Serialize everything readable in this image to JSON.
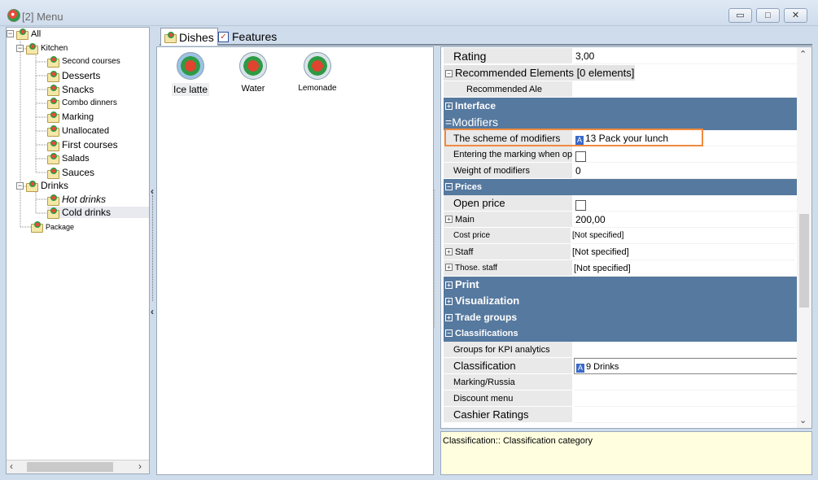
{
  "window": {
    "title": "[2] Menu",
    "buttons": [
      "minimize",
      "restore",
      "close"
    ]
  },
  "tree": {
    "root": "All",
    "groups": [
      {
        "label": "Kitchen",
        "children": [
          "Second courses",
          "Desserts",
          "Snacks",
          "Combo dinners",
          "Marking",
          "Unallocated",
          "First courses",
          "Salads",
          "Sauces"
        ]
      },
      {
        "label": "Drinks",
        "children": [
          "Hot drinks",
          "Cold drinks"
        ]
      },
      {
        "label": "Package",
        "children": []
      }
    ],
    "selected": "Cold drinks"
  },
  "tabs": [
    {
      "label": "Dishes",
      "active": true
    },
    {
      "label": "Features",
      "active": false
    }
  ],
  "dishes": [
    {
      "label": "Ice latte",
      "selected": true
    },
    {
      "label": "Water",
      "selected": false
    },
    {
      "label": "Lemonade",
      "selected": false
    }
  ],
  "properties": {
    "rating": {
      "key": "Rating",
      "value": "3,00"
    },
    "recommended_header": "Recommended Elements [0 elements]",
    "recommended_ale": "Recommended Ale",
    "interface": "Interface",
    "modifiers": "Modifiers",
    "scheme": {
      "key": "The scheme of modifiers",
      "value": "13 Pack your lunch"
    },
    "entering_marking": {
      "key": "Entering the marking when opl"
    },
    "weight_modifiers": {
      "key": "Weight of modifiers",
      "value": "0"
    },
    "prices": "Prices",
    "open_price": {
      "key": "Open price"
    },
    "main": {
      "key": "Main",
      "value": "200,00"
    },
    "cost_price": {
      "key": "Cost price",
      "value": "[Not specified]"
    },
    "staff": {
      "key": "Staff",
      "value": "[Not specified]"
    },
    "those_staff": {
      "key": "Those. staff",
      "value": "[Not specified]"
    },
    "print": "Print",
    "visualization": "Visualization",
    "trade_groups": "Trade groups",
    "classifications": "Classifications",
    "kpi": {
      "key": "Groups for KPI analytics"
    },
    "classification": {
      "key": "Classification",
      "value": "9 Drinks"
    },
    "marking_russia": {
      "key": "Marking/Russia"
    },
    "discount_menu": {
      "key": "Discount menu"
    },
    "cashier_ratings": {
      "key": "Cashier Ratings"
    }
  },
  "description": "Classification:: Classification category",
  "colors": {
    "category_bar": "#56799f",
    "highlight_border": "#f08a3e",
    "description_bg": "#ffffe0"
  }
}
